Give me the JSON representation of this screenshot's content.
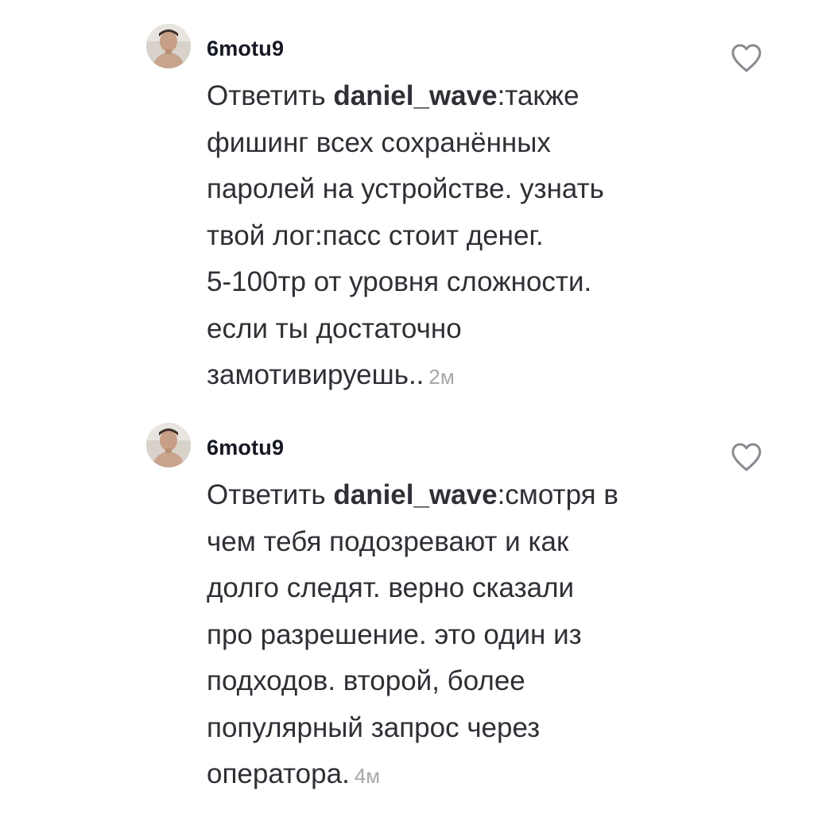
{
  "comments": [
    {
      "username": "6motu9",
      "reply_prefix": "Ответить ",
      "mention": "daniel_wave",
      "lines": [
        ":также",
        "фишинг всех сохранённых",
        "паролей на устройстве. узнать",
        "твой лог:пасс стоит денег.",
        "5-100тр от уровня сложности.",
        "если ты достаточно",
        "замотивируешь.."
      ],
      "time": "2м",
      "avatar_icon": "user-avatar-icon",
      "like_icon": "heart-outline-icon"
    },
    {
      "username": "6motu9",
      "reply_prefix": "Ответить ",
      "mention": "daniel_wave",
      "lines": [
        ":смотря в",
        "чем тебя подозревают и как",
        "долго следят. верно сказали",
        "про разрешение. это один из",
        "подходов. второй, более",
        "популярный запрос через",
        "оператора."
      ],
      "time": "4м",
      "avatar_icon": "user-avatar-icon",
      "like_icon": "heart-outline-icon"
    }
  ]
}
